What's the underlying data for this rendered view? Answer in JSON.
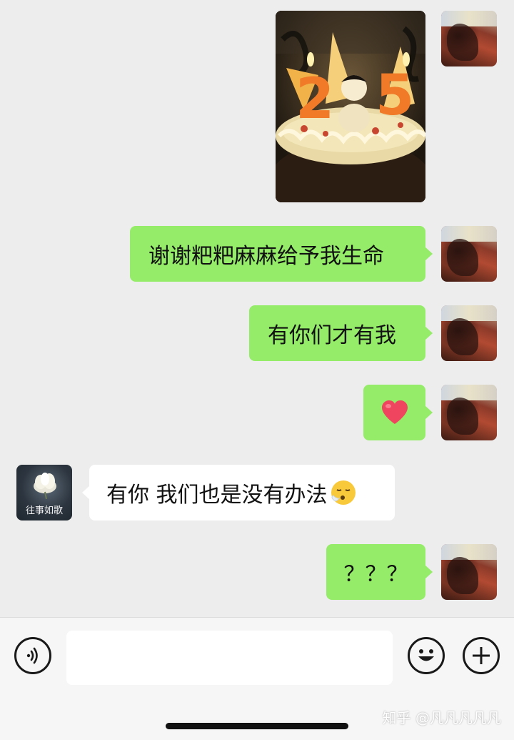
{
  "messages": [
    {
      "id": "m1",
      "side": "self",
      "type": "image",
      "image_desc": "birthday-cake-photo",
      "candle_text": "25"
    },
    {
      "id": "m2",
      "side": "self",
      "type": "text",
      "text": "谢谢粑粑麻麻给予我生命"
    },
    {
      "id": "m3",
      "side": "self",
      "type": "text",
      "text": "有你们才有我"
    },
    {
      "id": "m4",
      "side": "self",
      "type": "emoji",
      "emoji": "heart-emoji"
    },
    {
      "id": "m5",
      "side": "other",
      "type": "text",
      "text": "有你 我们也是没有办法",
      "trailing_emoji": "😮‍💨"
    },
    {
      "id": "m6",
      "side": "self",
      "type": "text",
      "text": "？？？"
    }
  ],
  "contact": {
    "avatar_caption": "往事如歌"
  },
  "input_bar": {
    "value": "",
    "voice_icon": "voice-icon",
    "emoji_icon": "smiley-icon",
    "plus_icon": "plus-icon"
  },
  "watermark": "知乎 @凡凡凡凡凡",
  "colors": {
    "self_bubble": "#95ec69",
    "other_bubble": "#ffffff",
    "chat_background": "#ededed",
    "heart": "#f0455e"
  }
}
